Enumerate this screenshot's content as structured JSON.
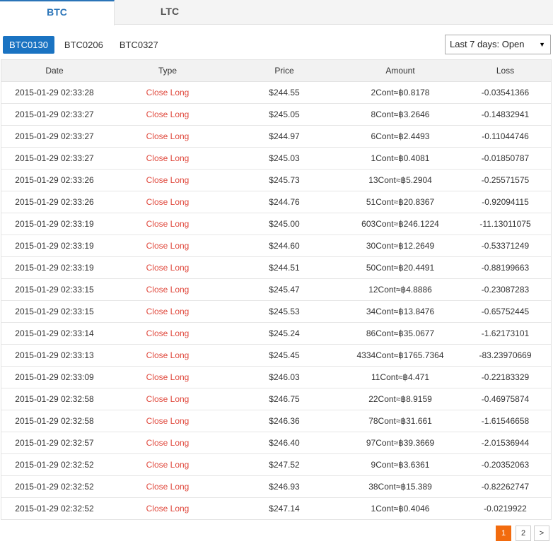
{
  "top_tabs": [
    {
      "label": "BTC",
      "active": true
    },
    {
      "label": "LTC",
      "active": false
    }
  ],
  "contract_tabs": [
    {
      "label": "BTC0130",
      "active": true
    },
    {
      "label": "BTC0206",
      "active": false
    },
    {
      "label": "BTC0327",
      "active": false
    }
  ],
  "filter": {
    "selected": "Last 7 days: Open",
    "arrow_icon": "caret-down-icon"
  },
  "table": {
    "headers": [
      "Date",
      "Type",
      "Price",
      "Amount",
      "Loss"
    ],
    "rows": [
      [
        "2015-01-29 02:33:28",
        "Close Long",
        "$244.55",
        "2Cont≈฿0.8178",
        "-0.03541366"
      ],
      [
        "2015-01-29 02:33:27",
        "Close Long",
        "$245.05",
        "8Cont≈฿3.2646",
        "-0.14832941"
      ],
      [
        "2015-01-29 02:33:27",
        "Close Long",
        "$244.97",
        "6Cont≈฿2.4493",
        "-0.11044746"
      ],
      [
        "2015-01-29 02:33:27",
        "Close Long",
        "$245.03",
        "1Cont≈฿0.4081",
        "-0.01850787"
      ],
      [
        "2015-01-29 02:33:26",
        "Close Long",
        "$245.73",
        "13Cont≈฿5.2904",
        "-0.25571575"
      ],
      [
        "2015-01-29 02:33:26",
        "Close Long",
        "$244.76",
        "51Cont≈฿20.8367",
        "-0.92094115"
      ],
      [
        "2015-01-29 02:33:19",
        "Close Long",
        "$245.00",
        "603Cont≈฿246.1224",
        "-11.13011075"
      ],
      [
        "2015-01-29 02:33:19",
        "Close Long",
        "$244.60",
        "30Cont≈฿12.2649",
        "-0.53371249"
      ],
      [
        "2015-01-29 02:33:19",
        "Close Long",
        "$244.51",
        "50Cont≈฿20.4491",
        "-0.88199663"
      ],
      [
        "2015-01-29 02:33:15",
        "Close Long",
        "$245.47",
        "12Cont≈฿4.8886",
        "-0.23087283"
      ],
      [
        "2015-01-29 02:33:15",
        "Close Long",
        "$245.53",
        "34Cont≈฿13.8476",
        "-0.65752445"
      ],
      [
        "2015-01-29 02:33:14",
        "Close Long",
        "$245.24",
        "86Cont≈฿35.0677",
        "-1.62173101"
      ],
      [
        "2015-01-29 02:33:13",
        "Close Long",
        "$245.45",
        "4334Cont≈฿1765.7364",
        "-83.23970669"
      ],
      [
        "2015-01-29 02:33:09",
        "Close Long",
        "$246.03",
        "11Cont≈฿4.471",
        "-0.22183329"
      ],
      [
        "2015-01-29 02:32:58",
        "Close Long",
        "$246.75",
        "22Cont≈฿8.9159",
        "-0.46975874"
      ],
      [
        "2015-01-29 02:32:58",
        "Close Long",
        "$246.36",
        "78Cont≈฿31.661",
        "-1.61546658"
      ],
      [
        "2015-01-29 02:32:57",
        "Close Long",
        "$246.40",
        "97Cont≈฿39.3669",
        "-2.01536944"
      ],
      [
        "2015-01-29 02:32:52",
        "Close Long",
        "$247.52",
        "9Cont≈฿3.6361",
        "-0.20352063"
      ],
      [
        "2015-01-29 02:32:52",
        "Close Long",
        "$246.93",
        "38Cont≈฿15.389",
        "-0.82262747"
      ],
      [
        "2015-01-29 02:32:52",
        "Close Long",
        "$247.14",
        "1Cont≈฿0.4046",
        "-0.0219922"
      ]
    ]
  },
  "pagination": {
    "pages": [
      "1",
      "2"
    ],
    "current": "1",
    "next_label": ">"
  },
  "colors": {
    "accent_blue": "#1a73c2",
    "close_long_red": "#e0493d",
    "active_page_orange": "#f26b0e"
  }
}
